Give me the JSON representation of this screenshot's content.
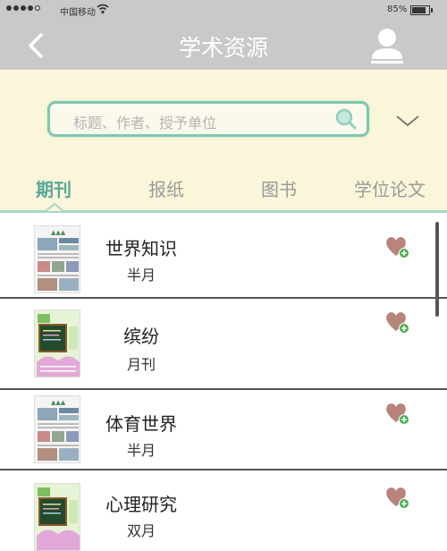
{
  "status_bar": {
    "carrier": "中国移动",
    "battery_text": "85%",
    "battery_level": 0.85
  },
  "nav": {
    "title": "学术资源",
    "back_icon": "chevron-left-icon",
    "user_icon": "user-icon"
  },
  "search": {
    "placeholder": "标题、作者、授予单位",
    "icon": "search-icon",
    "dropdown_icon": "chevron-down-icon"
  },
  "tabs": [
    {
      "label": "期刊",
      "active": true
    },
    {
      "label": "报纸",
      "active": false
    },
    {
      "label": "图书",
      "active": false
    },
    {
      "label": "学位论文",
      "active": false
    }
  ],
  "items": [
    {
      "title": "世界知识",
      "frequency": "半月",
      "cover": "newspaper"
    },
    {
      "title": "缤纷",
      "frequency": "月刊",
      "cover": "blackboard"
    },
    {
      "title": "体育世界",
      "frequency": "半月",
      "cover": "newspaper"
    },
    {
      "title": "心理研究",
      "frequency": "双月",
      "cover": "blackboard"
    }
  ],
  "colors": {
    "accent": "#5aa79c",
    "nav_bg": "#c9c9c9",
    "search_bg": "#fbf6d9",
    "favorite": "#b8847c"
  }
}
